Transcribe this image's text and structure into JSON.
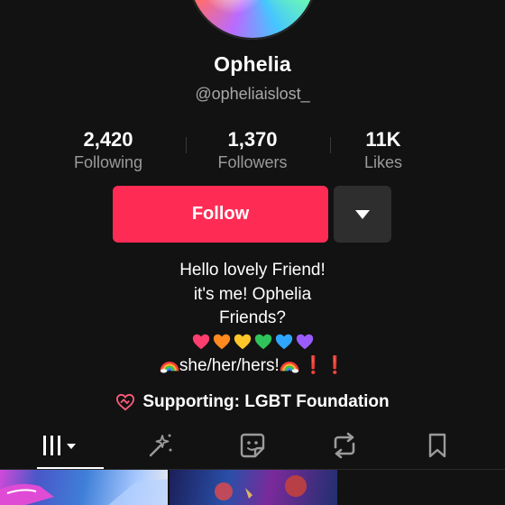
{
  "profile": {
    "name": "Ophelia",
    "handle": "@opheliaislost_"
  },
  "stats": [
    {
      "value": "2,420",
      "label": "Following"
    },
    {
      "value": "1,370",
      "label": "Followers"
    },
    {
      "value": "11K",
      "label": "Likes"
    }
  ],
  "actions": {
    "follow_label": "Follow",
    "more_icon": "caret-down-icon"
  },
  "bio": {
    "line1": "Hello lovely Friend!",
    "line2": "it's me! Ophelia",
    "line3": "Friends?",
    "heart_colors": [
      "#ff3d6e",
      "#ff8a1f",
      "#ffc629",
      "#2fc45a",
      "#2ea6ff",
      "#9b5cff"
    ],
    "pronouns": "she/her/hers!",
    "exclamations": "❗❗"
  },
  "support": {
    "label": "Supporting: LGBT Foundation",
    "icon": "heart-handshake-icon"
  },
  "tabs": [
    {
      "icon": "videos-grid-icon",
      "active": true
    },
    {
      "icon": "sparkle-icon"
    },
    {
      "icon": "sticker-icon"
    },
    {
      "icon": "repost-icon"
    },
    {
      "icon": "bookmark-icon"
    }
  ],
  "colors": {
    "accent": "#fe2c55",
    "background": "#121212",
    "secondary_text": "#a8a8a8"
  }
}
